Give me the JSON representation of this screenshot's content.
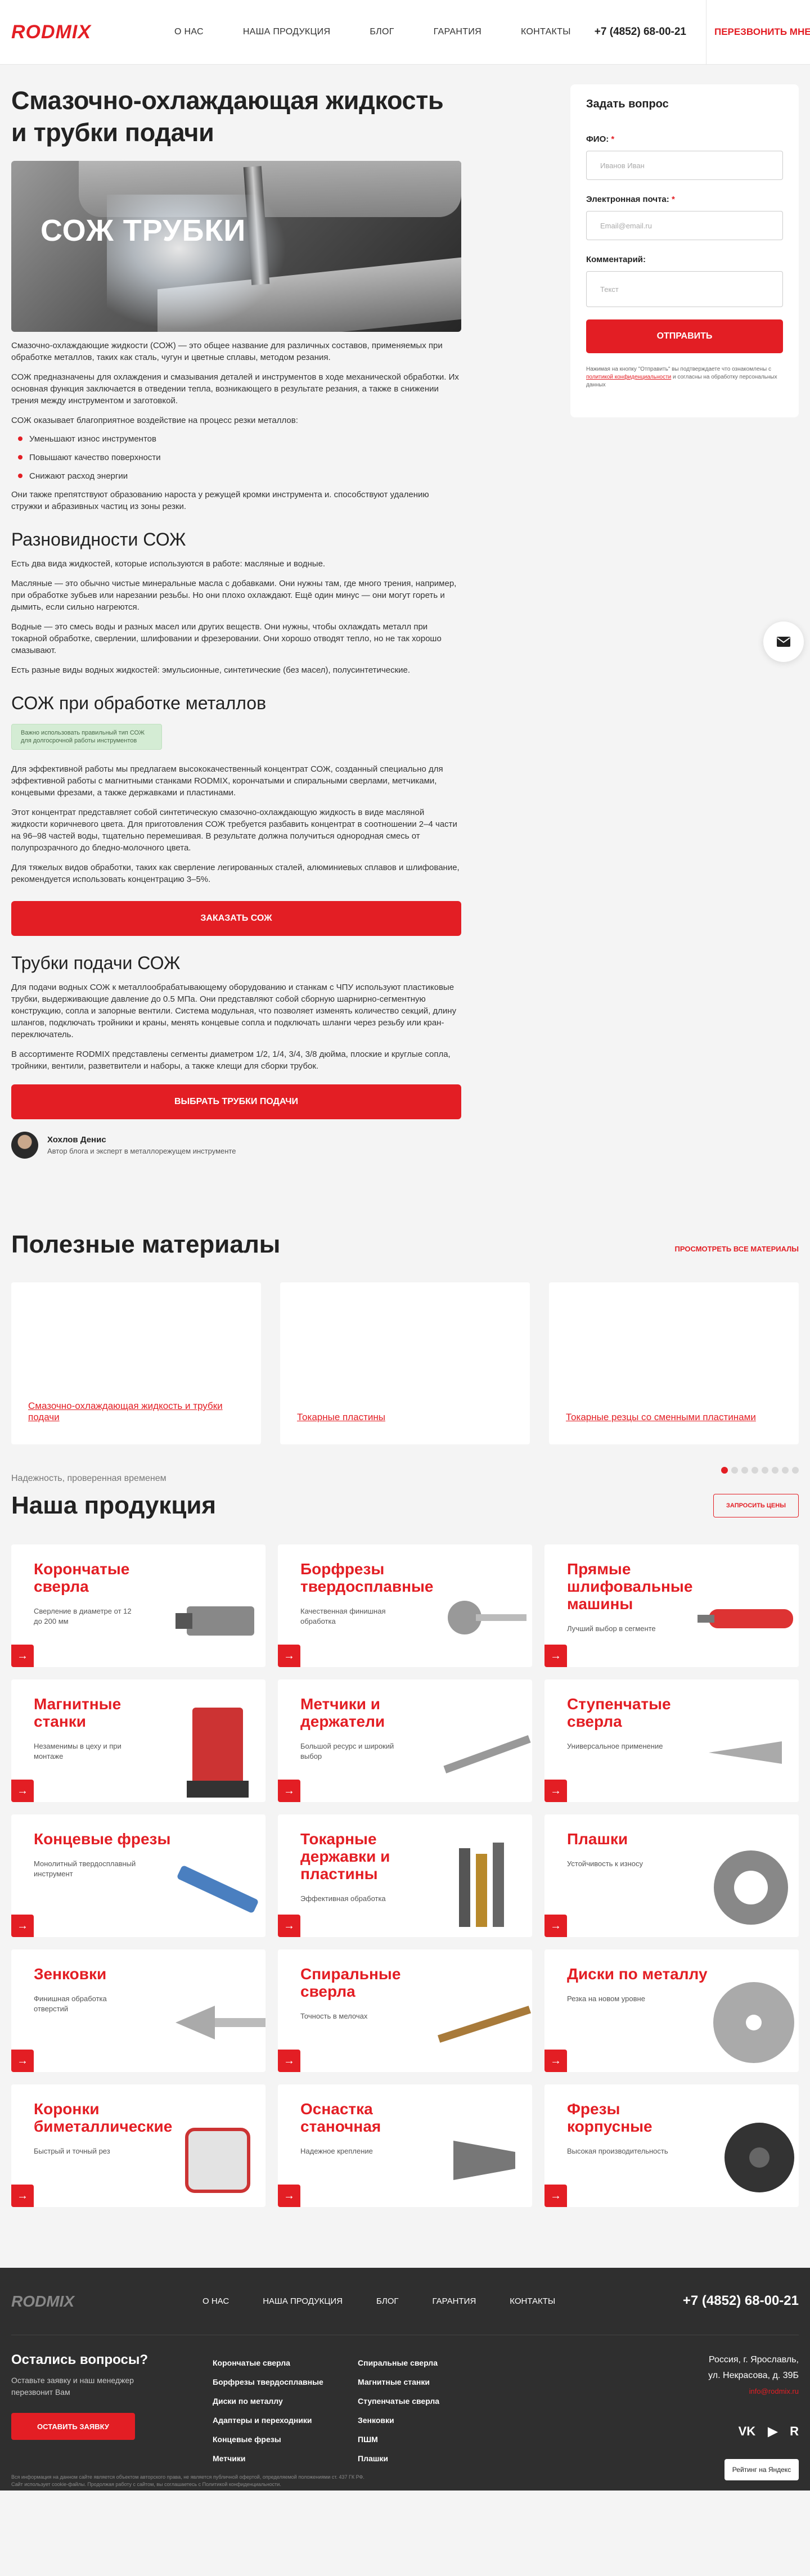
{
  "header": {
    "logo": "RODMIX",
    "nav": [
      "О НАС",
      "НАША ПРОДУКЦИЯ",
      "БЛОГ",
      "ГАРАНТИЯ",
      "КОНТАКТЫ"
    ],
    "phone": "+7 (4852) 68-00-21",
    "callback": "ПЕРЕЗВОНИТЬ МНЕ"
  },
  "article": {
    "title": "Смазочно-охлаждающая жидкость и трубки подачи",
    "hero_text": "СОЖ ТРУБКИ",
    "p1": "Смазочно-охлаждающие жидкости (СОЖ) — это общее название для различных составов, применяемых при обработке металлов, таких как сталь, чугун и цветные сплавы, методом резания.",
    "p2": "СОЖ предназначены для охлаждения и смазывания деталей и инструментов в ходе механической обработки. Их основная функция заключается в отведении тепла, возникающего в результате резания, а также в снижении трения между инструментом и заготовкой.",
    "p3": "СОЖ оказывает благоприятное воздействие на процесс резки металлов:",
    "bullets": [
      "Уменьшают износ инструментов",
      "Повышают качество поверхности",
      "Снижают расход энергии"
    ],
    "p4": "Они также препятствуют образованию нароста у режущей кромки инструмента и. способствуют удалению стружки и абразивных частиц из зоны резки.",
    "h_kinds": "Разновидности СОЖ",
    "k1": "Есть два вида жидкостей, которые используются в работе: масляные и водные.",
    "k2": "Масляные — это обычно чистые минеральные масла с добавками. Они нужны там, где много трения, например, при обработке зубьев или нарезании резьбы. Но они плохо охлаждают. Ещё один минус — они могут гореть и дымить, если сильно нагреются.",
    "k3": "Водные — это смесь воды и разных масел или других веществ. Они нужны, чтобы охлаждать металл при токарной обработке, сверлении, шлифовании и фрезеровании. Они хорошо отводят тепло, но не так хорошо смазывают.",
    "k4": "Есть разные виды водных жидкостей: эмульсионные, синтетические (без масел), полусинтетические.",
    "h_metal": "СОЖ при обработке металлов",
    "note": "Важно использовать правильный тип СОЖ для долгосрочной работы инструментов",
    "m1": "Для эффективной работы мы предлагаем высококачественный концентрат СОЖ, созданный специально для эффективной работы с магнитными станками RODMIX, корончатыми и спиральными сверлами, метчиками, концевыми фрезами, а также державками и пластинами.",
    "m2": "Этот концентрат представляет собой синтетическую смазочно-охлаждающую жидкость в виде масляной жидкости коричневого цвета. Для приготовления СОЖ требуется разбавить концентрат в соотношении 2–4 части на 96–98 частей воды, тщательно перемешивая. В результате должна получиться однородная смесь от полупрозрачного до бледно-молочного цвета.",
    "m3": "Для тяжелых видов обработки, таких как сверление легированных сталей, алюминиевых сплавов и шлифование, рекомендуется использовать концентрацию 3–5%.",
    "btn_order": "ЗАКАЗАТЬ СОЖ",
    "h_tubes": "Трубки подачи СОЖ",
    "t1": "Для подачи водных СОЖ к металлообрабатывающему оборудованию и станкам с ЧПУ используют пластиковые трубки, выдерживающие давление до 0.5 МПа. Они представляют собой сборную шарнирно-сегментную конструкцию, сопла и запорные вентили. Система модульная, что позволяет изменять количество секций, длину шлангов, подключать тройники и краны, менять концевые сопла и подключать шланги через резьбу или кран-переключатель.",
    "t2": "В ассортименте RODMIX представлены сегменты диаметром 1/2, 1/4, 3/4, 3/8 дюйма, плоские и круглые сопла, тройники, вентили, разветвители и наборы, а также клещи для сборки трубок.",
    "btn_tubes": "ВЫБРАТЬ ТРУБКИ ПОДАЧИ",
    "author_name": "Хохлов Денис",
    "author_role": "Автор блога и эксперт в металлорежущем инструменте"
  },
  "form": {
    "title": "Задать вопрос",
    "name_label": "ФИО:",
    "name_ph": "Иванов Иван",
    "email_label": "Электронная почта:",
    "email_ph": "Email@email.ru",
    "comment_label": "Комментарий:",
    "comment_ph": "Текст",
    "req": "*",
    "send": "ОТПРАВИТЬ",
    "agree_a": "Нажимая на кнопку \"Отправить\" вы подтверждаете что ознакомлены с ",
    "agree_link": "политикой конфиденциальности",
    "agree_b": " и согласны на обработку персональных данных"
  },
  "materials": {
    "title": "Полезные материалы",
    "all": "ПРОСМОТРЕТЬ ВСЕ МАТЕРИАЛЫ",
    "items": [
      "Смазочно-охлаждающая жидкость и трубки подачи",
      "Токарные пластины",
      "Токарные резцы со сменными пластинами"
    ],
    "dots": 8
  },
  "products": {
    "subtitle": "Надежность, проверенная временем",
    "title": "Наша продукция",
    "cta": "ЗАПРОСИТЬ ЦЕНЫ",
    "items": [
      {
        "name": "Корончатые сверла",
        "desc": "Сверление в диаметре от 12 до 200 мм",
        "icon": "annular-cutter"
      },
      {
        "name": "Борфрезы твердосплавные",
        "desc": "Качественная финишная обработка",
        "icon": "burr"
      },
      {
        "name": "Прямые шлифовальные машины",
        "desc": "Лучший выбор в сегменте",
        "icon": "grinder"
      },
      {
        "name": "Магнитные станки",
        "desc": "Незаменимы в цеху и при монтаже",
        "icon": "magnetic-drill"
      },
      {
        "name": "Метчики и держатели",
        "desc": "Большой ресурс и широкий выбор",
        "icon": "tap"
      },
      {
        "name": "Ступенчатые сверла",
        "desc": "Универсальное применение",
        "icon": "step-drill"
      },
      {
        "name": "Концевые фрезы",
        "desc": "Монолитный твердосплавный инструмент",
        "icon": "end-mill"
      },
      {
        "name": "Токарные державки и пластины",
        "desc": "Эффективная обработка",
        "icon": "turning-holder"
      },
      {
        "name": "Плашки",
        "desc": "Устойчивость к износу",
        "icon": "die"
      },
      {
        "name": "Зенковки",
        "desc": "Финишная обработка отверстий",
        "icon": "countersink"
      },
      {
        "name": "Спиральные сверла",
        "desc": "Точность в мелочах",
        "icon": "twist-drill"
      },
      {
        "name": "Диски по металлу",
        "desc": "Резка на новом уровне",
        "icon": "saw-disc"
      },
      {
        "name": "Коронки биметаллические",
        "desc": "Быстрый и точный рез",
        "icon": "hole-saw"
      },
      {
        "name": "Оснастка станочная",
        "desc": "Надежное крепление",
        "icon": "tool-holder"
      },
      {
        "name": "Фрезы корпусные",
        "desc": "Высокая производительность",
        "icon": "face-mill"
      }
    ]
  },
  "footer": {
    "logo": "RODMIX",
    "nav": [
      "О НАС",
      "НАША ПРОДУКЦИЯ",
      "БЛОГ",
      "ГАРАНТИЯ",
      "КОНТАКТЫ"
    ],
    "phone": "+7 (4852) 68-00-21",
    "q_title": "Остались вопросы?",
    "q_text": "Оставьте заявку и наш менеджер перезвонит Вам",
    "q_btn": "ОСТАВИТЬ ЗАЯВКУ",
    "col1": [
      "Корончатые сверла",
      "Борфрезы твердосплавные",
      "Диски по металлу",
      "Адаптеры и переходники",
      "Концевые фрезы",
      "Метчики"
    ],
    "col2": [
      "Спиральные сверла",
      "Магнитные станки",
      "Ступенчатые сверла",
      "Зенковки",
      "ПШМ",
      "Плашки"
    ],
    "address1": "Россия, г. Ярославль,",
    "address2": "ул. Некрасова, д. 39Б",
    "email": "info@rodmix.ru",
    "socials": [
      "VK",
      "YouTube",
      "Rutube"
    ],
    "rating": "Рейтинг на Яндекс",
    "copy1": "Вся информация на данном сайте является объектом авторского права, не является публичной офертой, определяемой положениями ст. 437 ГК РФ.",
    "copy2": "Сайт использует cookie-файлы. Продолжая работу с сайтом, вы соглашаетесь с Политикой конфиденциальности."
  },
  "colors": {
    "accent": "#e31e24",
    "footer_bg": "#2f2f2f",
    "page_bg": "#f4f4f4"
  }
}
